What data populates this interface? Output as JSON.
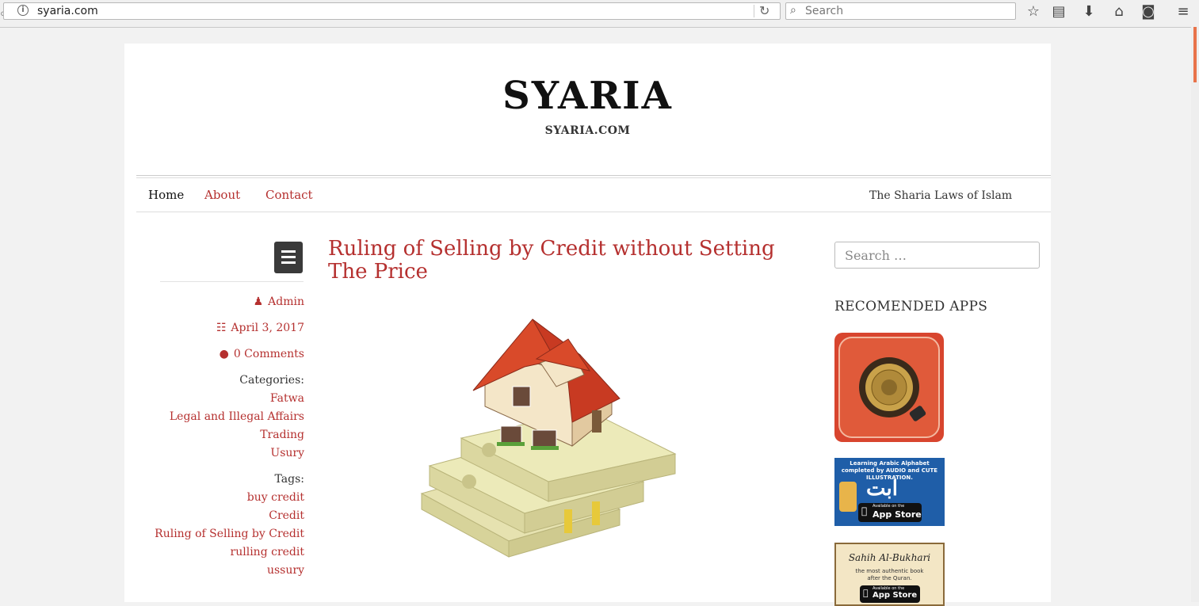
{
  "browser": {
    "url": "syaria.com",
    "search_placeholder": "Search"
  },
  "site": {
    "logo": "SYARIA",
    "domain": "SYARIA.COM",
    "description": "The Sharia Laws of Islam"
  },
  "nav": {
    "items": [
      {
        "label": "Home"
      },
      {
        "label": "About"
      },
      {
        "label": "Contact"
      }
    ]
  },
  "post": {
    "title": "Ruling of Selling by Credit without Setting The Price",
    "author": "Admin",
    "date": "April 3, 2017",
    "comments": "0 Comments",
    "categories_label": "Categories:",
    "categories": [
      "Fatwa",
      "Legal and Illegal Affairs",
      "Trading",
      "Usury"
    ],
    "tags_label": "Tags:",
    "tags": [
      "buy credit",
      "Credit",
      "Ruling of Selling by Credit",
      "rulling credit",
      "ussury"
    ]
  },
  "sidebar": {
    "search_placeholder": "Search …",
    "heading": "RECOMENDED APPS",
    "app2_text": "Learning Arabic Alphabet completed by AUDIO and CUTE ILLUSTRATION.",
    "app2_store": "App Store",
    "app2_store_small": "Available on the",
    "app3_title": "Sahih Al-Bukhari",
    "app3_sub": "the most authentic book after the Quran.",
    "app3_store": "App Store",
    "app3_store_small": "Available on the"
  },
  "colors": {
    "accent": "#b5302f",
    "menu_button": "#3a3a3a"
  }
}
